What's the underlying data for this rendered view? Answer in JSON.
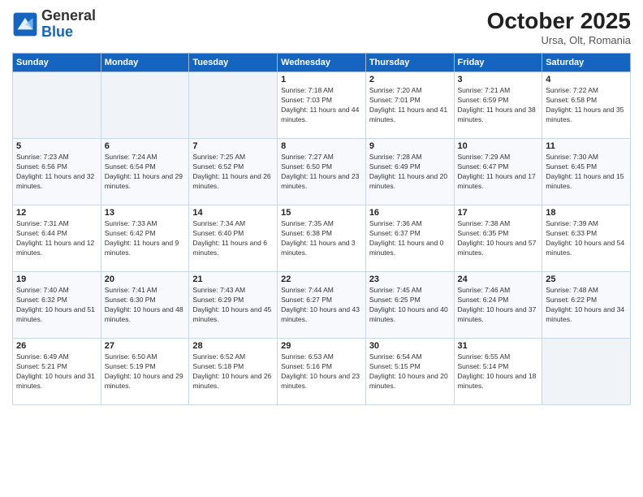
{
  "header": {
    "logo_general": "General",
    "logo_blue": "Blue",
    "month": "October 2025",
    "location": "Ursa, Olt, Romania"
  },
  "weekdays": [
    "Sunday",
    "Monday",
    "Tuesday",
    "Wednesday",
    "Thursday",
    "Friday",
    "Saturday"
  ],
  "weeks": [
    [
      {
        "day": "",
        "empty": true
      },
      {
        "day": "",
        "empty": true
      },
      {
        "day": "",
        "empty": true
      },
      {
        "day": "1",
        "sunrise": "7:18 AM",
        "sunset": "7:03 PM",
        "daylight": "11 hours and 44 minutes."
      },
      {
        "day": "2",
        "sunrise": "7:20 AM",
        "sunset": "7:01 PM",
        "daylight": "11 hours and 41 minutes."
      },
      {
        "day": "3",
        "sunrise": "7:21 AM",
        "sunset": "6:59 PM",
        "daylight": "11 hours and 38 minutes."
      },
      {
        "day": "4",
        "sunrise": "7:22 AM",
        "sunset": "6:58 PM",
        "daylight": "11 hours and 35 minutes."
      }
    ],
    [
      {
        "day": "5",
        "sunrise": "7:23 AM",
        "sunset": "6:56 PM",
        "daylight": "11 hours and 32 minutes."
      },
      {
        "day": "6",
        "sunrise": "7:24 AM",
        "sunset": "6:54 PM",
        "daylight": "11 hours and 29 minutes."
      },
      {
        "day": "7",
        "sunrise": "7:25 AM",
        "sunset": "6:52 PM",
        "daylight": "11 hours and 26 minutes."
      },
      {
        "day": "8",
        "sunrise": "7:27 AM",
        "sunset": "6:50 PM",
        "daylight": "11 hours and 23 minutes."
      },
      {
        "day": "9",
        "sunrise": "7:28 AM",
        "sunset": "6:49 PM",
        "daylight": "11 hours and 20 minutes."
      },
      {
        "day": "10",
        "sunrise": "7:29 AM",
        "sunset": "6:47 PM",
        "daylight": "11 hours and 17 minutes."
      },
      {
        "day": "11",
        "sunrise": "7:30 AM",
        "sunset": "6:45 PM",
        "daylight": "11 hours and 15 minutes."
      }
    ],
    [
      {
        "day": "12",
        "sunrise": "7:31 AM",
        "sunset": "6:44 PM",
        "daylight": "11 hours and 12 minutes."
      },
      {
        "day": "13",
        "sunrise": "7:33 AM",
        "sunset": "6:42 PM",
        "daylight": "11 hours and 9 minutes."
      },
      {
        "day": "14",
        "sunrise": "7:34 AM",
        "sunset": "6:40 PM",
        "daylight": "11 hours and 6 minutes."
      },
      {
        "day": "15",
        "sunrise": "7:35 AM",
        "sunset": "6:38 PM",
        "daylight": "11 hours and 3 minutes."
      },
      {
        "day": "16",
        "sunrise": "7:36 AM",
        "sunset": "6:37 PM",
        "daylight": "11 hours and 0 minutes."
      },
      {
        "day": "17",
        "sunrise": "7:38 AM",
        "sunset": "6:35 PM",
        "daylight": "10 hours and 57 minutes."
      },
      {
        "day": "18",
        "sunrise": "7:39 AM",
        "sunset": "6:33 PM",
        "daylight": "10 hours and 54 minutes."
      }
    ],
    [
      {
        "day": "19",
        "sunrise": "7:40 AM",
        "sunset": "6:32 PM",
        "daylight": "10 hours and 51 minutes."
      },
      {
        "day": "20",
        "sunrise": "7:41 AM",
        "sunset": "6:30 PM",
        "daylight": "10 hours and 48 minutes."
      },
      {
        "day": "21",
        "sunrise": "7:43 AM",
        "sunset": "6:29 PM",
        "daylight": "10 hours and 45 minutes."
      },
      {
        "day": "22",
        "sunrise": "7:44 AM",
        "sunset": "6:27 PM",
        "daylight": "10 hours and 43 minutes."
      },
      {
        "day": "23",
        "sunrise": "7:45 AM",
        "sunset": "6:25 PM",
        "daylight": "10 hours and 40 minutes."
      },
      {
        "day": "24",
        "sunrise": "7:46 AM",
        "sunset": "6:24 PM",
        "daylight": "10 hours and 37 minutes."
      },
      {
        "day": "25",
        "sunrise": "7:48 AM",
        "sunset": "6:22 PM",
        "daylight": "10 hours and 34 minutes."
      }
    ],
    [
      {
        "day": "26",
        "sunrise": "6:49 AM",
        "sunset": "5:21 PM",
        "daylight": "10 hours and 31 minutes."
      },
      {
        "day": "27",
        "sunrise": "6:50 AM",
        "sunset": "5:19 PM",
        "daylight": "10 hours and 29 minutes."
      },
      {
        "day": "28",
        "sunrise": "6:52 AM",
        "sunset": "5:18 PM",
        "daylight": "10 hours and 26 minutes."
      },
      {
        "day": "29",
        "sunrise": "6:53 AM",
        "sunset": "5:16 PM",
        "daylight": "10 hours and 23 minutes."
      },
      {
        "day": "30",
        "sunrise": "6:54 AM",
        "sunset": "5:15 PM",
        "daylight": "10 hours and 20 minutes."
      },
      {
        "day": "31",
        "sunrise": "6:55 AM",
        "sunset": "5:14 PM",
        "daylight": "10 hours and 18 minutes."
      },
      {
        "day": "",
        "empty": true
      }
    ]
  ]
}
